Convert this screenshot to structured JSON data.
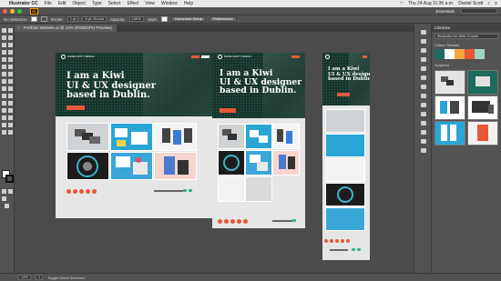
{
  "menubar": {
    "app_name": "Illustrator CC",
    "items": [
      "File",
      "Edit",
      "Object",
      "Type",
      "Select",
      "Effect",
      "View",
      "Window",
      "Help"
    ],
    "datetime": "Thu 24 Aug  11:36 a.m.",
    "user": "Daniel Scott"
  },
  "appbar": {
    "logo": "Ai",
    "workspace": "Essentials"
  },
  "control": {
    "selection": "No Selection",
    "stroke_label": "Stroke:",
    "stroke_value": "1 pt",
    "brush": "5 pt. Round",
    "opacity_label": "Opacity:",
    "opacity_value": "100%",
    "style_label": "Style:",
    "doc_setup": "Document Setup",
    "preferences": "Preferences"
  },
  "document": {
    "tab_title": "Portfolio Website.ai @ 14% (RGB/GPU Preview)"
  },
  "artwork": {
    "headline": [
      "I am a Kiwi",
      "UI & UX designer",
      "based in Dublin."
    ],
    "nav_brand": "DANIEL SCOTT | DESIGN",
    "colors": {
      "hero": "#14352c",
      "accent": "#e8573a",
      "social": "#2eb888"
    }
  },
  "libraries": {
    "title": "Libraries",
    "library_name": "Illustrator for Web Course",
    "colors_label": "Colour Themes",
    "graphics_label": "Graphics",
    "theme_colors": [
      "#1f6e63",
      "#ffffff",
      "#f5a640",
      "#e8573a",
      "#9fd7c0"
    ]
  },
  "status": {
    "zoom": "14%",
    "page": "1",
    "tool": "Toggle Direct Selection"
  }
}
